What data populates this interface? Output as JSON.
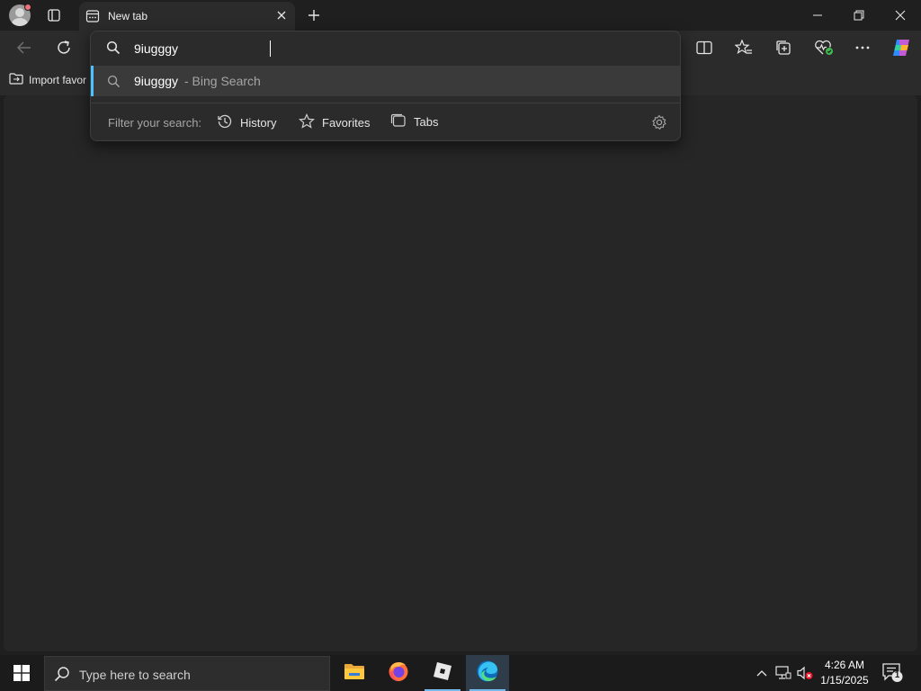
{
  "browser": {
    "tab": {
      "title": "New tab"
    },
    "favorites_bar": {
      "import_label": "Import favor"
    }
  },
  "omnibox": {
    "query": "9iugggy",
    "suggestion": {
      "text": "9iugggy",
      "source": "- Bing Search"
    },
    "filter": {
      "label": "Filter your search:",
      "history": "History",
      "favorites": "Favorites",
      "tabs": "Tabs"
    }
  },
  "taskbar": {
    "search_placeholder": "Type here to search",
    "clock": {
      "time": "4:26 AM",
      "date": "1/15/2025"
    },
    "notification_count": "1",
    "apps": [
      "file-explorer",
      "firefox",
      "roblox",
      "microsoft-edge"
    ]
  },
  "colors": {
    "accent": "#4cc2ff",
    "background": "#1f1f1f",
    "toolbar": "#2b2b2b"
  }
}
